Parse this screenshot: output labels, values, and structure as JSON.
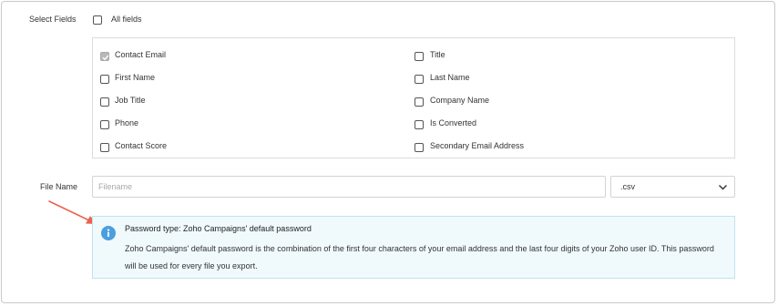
{
  "select_fields": {
    "label": "Select Fields",
    "all_fields_label": "All fields",
    "all_fields_checked": false
  },
  "fields": [
    {
      "label": "Contact Email",
      "checked": true
    },
    {
      "label": "Title",
      "checked": false
    },
    {
      "label": "First Name",
      "checked": false
    },
    {
      "label": "Last Name",
      "checked": false
    },
    {
      "label": "Job Title",
      "checked": false
    },
    {
      "label": "Company Name",
      "checked": false
    },
    {
      "label": "Phone",
      "checked": false
    },
    {
      "label": "Is Converted",
      "checked": false
    },
    {
      "label": "Contact Score",
      "checked": false
    },
    {
      "label": "Secondary Email Address",
      "checked": false
    }
  ],
  "file_name": {
    "label": "File Name",
    "placeholder": "Filename",
    "value": "",
    "format_selected": ".csv"
  },
  "info": {
    "title": "Password type: Zoho Campaigns' default password",
    "text": "Zoho Campaigns' default password is the combination of the first four characters of your email address and the last four digits of your Zoho user ID. This password will be used for every file you export."
  },
  "colors": {
    "info_icon": "#4a9fe0",
    "info_background": "#f0fafd",
    "info_border": "#bfe3ef",
    "arrow": "#e8634e",
    "checked_box": "#b8b8b8"
  }
}
